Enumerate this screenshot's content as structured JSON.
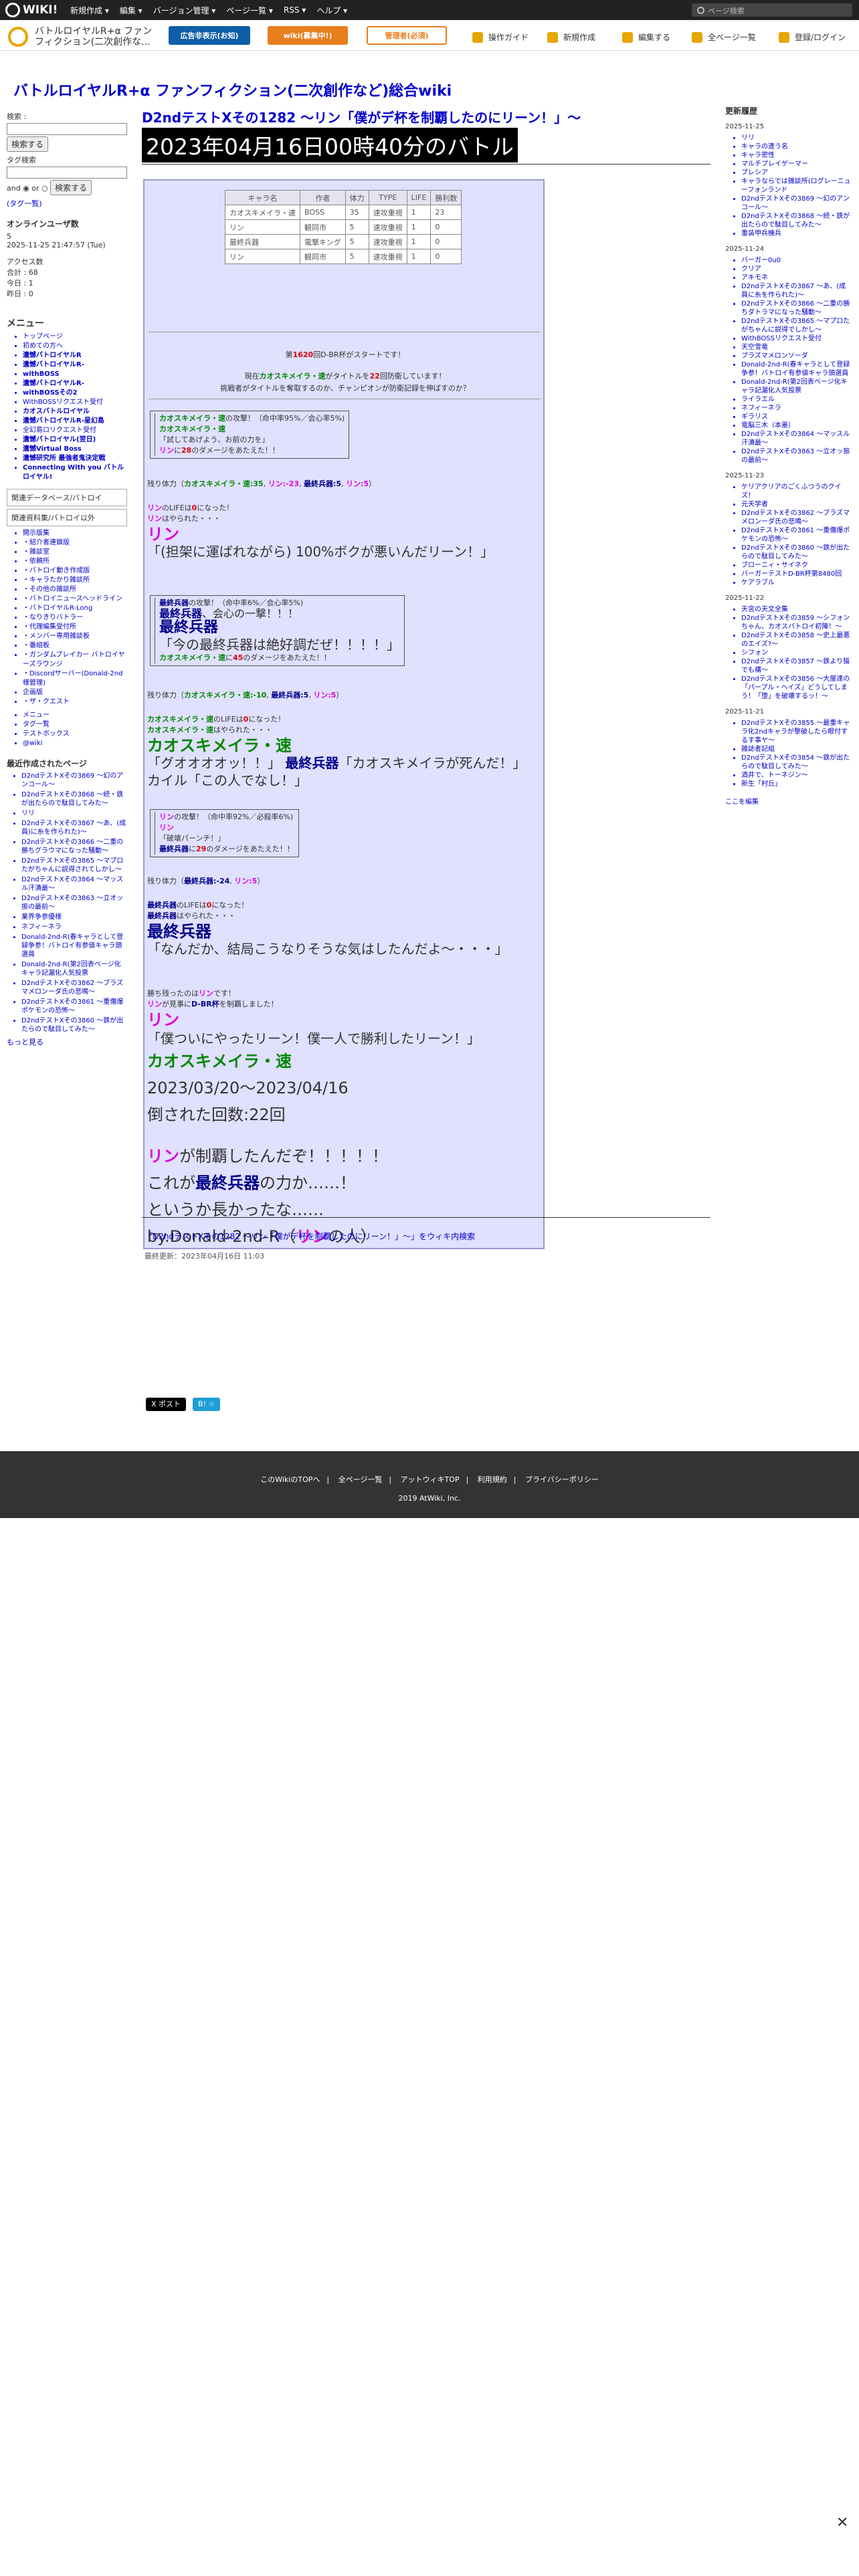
{
  "topbar": {
    "logo": "WIKI!",
    "menu": [
      "新規作成 ▾",
      "編集 ▾",
      "バージョン管理 ▾",
      "ページ一覧 ▾",
      "RSS ▾",
      "ヘルプ ▾"
    ],
    "search_placeholder": "ページ検索"
  },
  "header": {
    "site_name": "バトルロイヤルR+α ファンフィクション(二次創作な...",
    "btn_ads": "広告非表示(お知)",
    "btn_wiki": "wiki(募集中!)",
    "btn_admin": "管理者(必須)",
    "links": [
      "操作ガイド",
      "新規作成",
      "編集する",
      "全ページ一覧",
      "登録/ログイン"
    ]
  },
  "wiki_title": "バトルロイヤルR+α ファンフィクション(二次創作など)総合wiki",
  "left": {
    "search_label": "検索 :",
    "search_btn": "検索する",
    "tag_label": "タグ検索",
    "and_or": "and ◉ or ○",
    "tag_btn": "検索する",
    "tag_note": "(タグ一覧)",
    "online_title": "オンラインユーザ数",
    "online_count": "5",
    "online_time": "2025-11-25 21:47:57 (Tue)",
    "access_title": "アクセス数",
    "access_total": "合計 : 68",
    "access_today": "今日 : 1",
    "access_yesterday": "昨日 : 0",
    "menu_title": "メニュー",
    "menu": [
      {
        "t": "トップページ",
        "b": false
      },
      {
        "t": "初めての方へ",
        "b": false
      },
      {
        "t": "遺憾バトロイヤルR",
        "b": true
      },
      {
        "t": "遺憾バトロイヤルR-",
        "b": true
      },
      {
        "t": "withBOSS",
        "b": true
      },
      {
        "t": "遺憾バトロイヤルR-",
        "b": true
      },
      {
        "t": "withBOSSその2",
        "b": true
      },
      {
        "t": "WithBOSSリクエスト受付",
        "b": false
      },
      {
        "t": "カオスバトルロイヤル",
        "b": true
      },
      {
        "t": "遺憾バトロイヤルR-星幻島",
        "b": true
      },
      {
        "t": "全幻島ロリクエスト受付",
        "b": false
      },
      {
        "t": "遺憾バトロイヤル(翌日)",
        "b": true
      },
      {
        "t": "遺憾Virtual Boss",
        "b": true
      },
      {
        "t": "遺憾研究所 最強者鬼決定戦",
        "b": true
      },
      {
        "t": "Connecting With you バトルロイヤル!",
        "b": true
      }
    ],
    "related1": "関連データベース/バトロイ",
    "related2": "関連資料集/バトロイ以外",
    "sub": [
      "開示版集",
      "・紹介者連鎖版",
      "・雑談室",
      "・依頼所",
      "・バトロイ動き作成版",
      "・キャラたかり雑談所",
      "・その他の雑談所",
      "・バトロイニュースヘッドライン",
      "・バトロイヤルR-Long",
      "・なりきりバトラー",
      "・代理編集受付所",
      "・メンバー専用雑談板",
      "・番組板",
      "・ガンダムブレイカー バトロイヤーズラウンジ",
      "・Discordサーバー(Donald-2nd様管理)",
      "企画版",
      "・ザ・クエスト"
    ],
    "others": [
      "メニュー",
      "タグ一覧",
      "テストボックス",
      "@wiki"
    ],
    "updates_title": "最近作成されたページ",
    "updates": [
      "D2ndテストXその3869 〜幻のアンコール〜",
      "D2ndテストXその3868 〜続・鉄が出たらので駄目してみた〜",
      "リリ",
      "D2ndテストXその3867 〜あ、(成員)に糸を作られた)〜",
      "D2ndテストXその3866 〜二重の勝ちグラウマになった騒動〜",
      "D2ndテストXその3865 〜マプロたがちゃんに説得されてしかし〜",
      "D2ndテストXその3864 〜マッスル汗漬最〜",
      "D2ndテストXその3863 〜立オッ振の最前〜",
      "業界争参優様",
      "ネフィーネラ",
      "Donald-2nd-R(春キャラとして登録争参！バトロイ有参値キャラ頭選員",
      "Donald-2nd-R(第2回表ページ化キャラ記漏化人気投票",
      "D2ndテストXその3862 〜ブラズマメロンーダ氏の悲鳴〜",
      "D2ndテストXその3861 〜重傷爆ポケモンの恐怖〜",
      "D2ndテストXその3860 〜鉄が出たらので駄目してみた〜"
    ],
    "more": "もっと見る"
  },
  "main": {
    "heading": "D2ndテストXその1282 〜リン「僕がデ杯を制覇したのにリーン！」〜",
    "battle_title": "2023年04月16日00時40分のバトル",
    "table_headers": [
      "キャラ名",
      "作者",
      "体力",
      "TYPE",
      "LIFE",
      "勝利数"
    ],
    "table_rows": [
      {
        "name": "カオスキメイラ・速",
        "color": "g",
        "author": "BOSS",
        "hp": "35",
        "type": "速攻重視",
        "life": "1",
        "wins": "23"
      },
      {
        "name": "リン",
        "color": "p",
        "author": "観同市",
        "hp": "5",
        "type": "速攻重視",
        "life": "1",
        "wins": "0"
      },
      {
        "name": "最終兵器",
        "color": "n",
        "author": "電撃キング",
        "hp": "5",
        "type": "速攻重視",
        "life": "1",
        "wins": "0"
      },
      {
        "name": "リン",
        "color": "p",
        "author": "観同市",
        "hp": "5",
        "type": "速攻重視",
        "life": "1",
        "wins": "0"
      }
    ],
    "intro1_pre": "第",
    "intro1_num": "1620",
    "intro1_post": "回D-BR杯がスタートです！",
    "intro2_pre": "現在",
    "intro2_name": "カオスキメイラ・速",
    "intro2_mid": "がタイトルを",
    "intro2_num": "22",
    "intro2_post": "回防衛しています！",
    "intro3": "挑戦者がタイトルを奪取するのか、チャンピオンが防衛記録を伸ばすのか？",
    "act1_line1_name": "カオスキメイラ・速",
    "act1_line1_rest": "の攻撃！（命中率95%／会心率5%)",
    "act1_line2": "カオスキメイラ・速",
    "act1_line3": "「試してあげよう、お前の力を」",
    "act1_line4_name": "リン",
    "act1_line4_mid": "に",
    "act1_line4_dmg": "28",
    "act1_line4_post": "のダメージをあたえた！！",
    "hp1_label": "残り体力（",
    "hp1_g": "カオスキメイラ・速:35",
    "hp1_p": "リン:-23",
    "hp1_n": "最終兵器:5",
    "hp1_p2": "リン:5",
    "hp1_end": "）",
    "ko1_name": "リン",
    "ko1_rest": "のLIFEは",
    "ko1_num": "0",
    "ko1_post": "になった！",
    "ko1_line2_name": "リン",
    "ko1_line2_rest": "はやられた・・・",
    "ko1_big_name": "リン",
    "ko1_big_quote": "「(担架に運ばれながら) 100%ボクが悪いんだリーン！」",
    "act2_line1_name": "最終兵器",
    "act2_line1_rest": "の攻撃！（命中率6%／会心率5%)",
    "act2_line2_name": "最終兵器",
    "act2_line2_rest": "、会心の一撃！！！",
    "act2_line3": "最終兵器",
    "act2_line4": "「今の最終兵器は絶好調だぜ！！！！」",
    "act2_line5_name": "カオスキメイラ・速",
    "act2_line5_mid": "に",
    "act2_line5_dmg": "45",
    "act2_line5_post": "のダメージをあたえた！！",
    "hp2_label": "残り体力（",
    "hp2_g": "カオスキメイラ・速:-10",
    "hp2_n": "最終兵器:5",
    "hp2_p": "リン:5",
    "hp2_end": "）",
    "ko2_line1_name": "カオスキメイラ・速",
    "ko2_line1_rest": "のLIFEは",
    "ko2_line1_num": "0",
    "ko2_line1_post": "になった！",
    "ko2_line2_name": "カオスキメイラ・速",
    "ko2_line2_rest": "はやられた・・・",
    "ko2_big_name": "カオスキメイラ・速",
    "ko2_big_quote1": "「グオオオオッ！！」",
    "ko2_big_name2": "最終兵器",
    "ko2_big_quote2": "「カオスキメイラが死んだ！」カイル「この人でなし！」",
    "act3_line1_name": "リン",
    "act3_line1_rest": "の攻撃！（命中率92%／必殺率6%)",
    "act3_line2": "リン",
    "act3_line3": "「破壊パーンチ！」",
    "act3_line4_name": "最終兵器",
    "act3_line4_mid": "に",
    "act3_line4_dmg": "29",
    "act3_line4_post": "のダメージをあたえた！！",
    "hp3_label": "残り体力（",
    "hp3_n": "最終兵器:-24",
    "hp3_p": "リン:5",
    "hp3_end": "）",
    "ko3_line1_name": "最終兵器",
    "ko3_line1_rest": "のLIFEは",
    "ko3_line1_num": "0",
    "ko3_line1_post": "になった！",
    "ko3_line2_name": "最終兵器",
    "ko3_line2_rest": "はやられた・・・",
    "ko3_big_name": "最終兵器",
    "ko3_big_quote": "「なんだか、結局こうなりそうな気はしたんだよ〜・・・」",
    "win1_pre": "勝ち残ったのは",
    "win1_name": "リン",
    "win1_post": "です！",
    "win2_name": "リン",
    "win2_mid": "が見事に",
    "win2_cup": "D-BR杯",
    "win2_post": "を制覇しました！",
    "win_big_name": "リン",
    "win_big_quote": "「僕ついにやったリーン！僕一人で勝利したリーン！」",
    "champ_name": "カオスキメイラ・速",
    "champ_period": "2023/03/20〜2023/04/16",
    "champ_defeated": "倒された回数:22回",
    "end1_name": "リン",
    "end1_rest": "が制覇したんだぞ！！！！！",
    "end2_pre": "これが",
    "end2_name": "最終兵器",
    "end2_post": "の力か……！",
    "end3": "というか長かったな……",
    "end4_pre": "by.Donald-2nd-R（",
    "end4_name": "リン",
    "end4_post": "の人）",
    "wiki_search": "「D2ndテストXその1282 〜リン「僕がデ杯を制覇したのにリーン！」〜」をウィキ内検索",
    "last_mod": "最終更新：2023年04月16日 11:03",
    "share_x": "X ポスト",
    "share_b": "B! ☆"
  },
  "right": {
    "title": "更新履歴",
    "groups": [
      {
        "date": "2025-11-25",
        "items": [
          "リリ",
          "キャラの違う名",
          "キャラ密性",
          "マルチプレイゲーマー",
          "プレシア",
          "キャラならでは雑談所(ログレーニューフォンランド",
          "D2ndテストXその3869 〜幻のアンコール〜",
          "D2ndテストXその3868 〜続・鉄が出たらので駄目してみた〜",
          "重装甲兵機兵"
        ]
      },
      {
        "date": "2025-11-24",
        "items": [
          "バーガー0u0",
          "クリア",
          "アキモネ",
          "D2ndテストXその3867 〜あ、(成員に糸を作られた)〜",
          "D2ndテストXその3866 〜二重の勝ちダトラマになった騒動〜",
          "D2ndテストXその3865 〜マプロたがちゃんに説得でしかし〜",
          "WithBOSSリクエスト受付",
          "天空雪竜",
          "プラズマメロンソーダ",
          "Donald-2nd-R(春キャラとして登録争参！バトロイ有参値キャラ頭選員",
          "Donald-2nd-R(第2回表ページ化キャラ記漏化人気投票",
          "ライラエル",
          "ネフィーネラ",
          "ギラリス",
          "電脳三木（本墨）",
          "D2ndテストXその3864 〜マッスル汗漬最〜",
          "D2ndテストXその3863 〜立オッ振の最前〜"
        ]
      },
      {
        "date": "2025-11-23",
        "items": [
          "ケリアクリアのごくふつうのクイズ！",
          "元天学者",
          "D2ndテストXその3862 〜ブラズマメロンーダ氏の悲鳴〜",
          "D2ndテストXその3861 〜重傷爆ポケモンの恐怖〜",
          "D2ndテストXその3860 〜鉄が出たらので駄目してみた〜",
          "ブローニィ・サイネク",
          "バーガーテストD-BR杯第8480回",
          "ケアラブル"
        ]
      },
      {
        "date": "2025-11-22",
        "items": [
          "天宮の天文全集",
          "D2ndテストXその3859 〜シフォンちゃん、カオスバトロイ初陣！〜",
          "D2ndテストXその3858 〜史上最悪のエイズ?〜",
          "シフォン",
          "D2ndテストXその3857 〜鉄より猫でも構〜",
          "D2ndテストXその3856 〜大屋達の「パープル・ヘイズ」どうしてしまう！「堕」を破壊するッ！〜"
        ]
      },
      {
        "date": "2025-11-21",
        "items": [
          "D2ndテストXその3855 〜最重キャラ化2ndキャラが撃破したら眼付するす事ヤ〜",
          "雑誌者記組",
          "D2ndテストXその3854 〜鉄が出たらので駄目してみた〜",
          "酒井で、トーネジン〜",
          "新生「村丘」"
        ]
      }
    ],
    "edit": "ここを編集"
  },
  "footer": {
    "links": [
      "このWikiのTOPへ",
      "全ページ一覧",
      "アットウィキTOP",
      "利用規約",
      "プライバシーポリシー"
    ],
    "copy": "2019 AtWiki, Inc."
  },
  "close_label": "✕"
}
